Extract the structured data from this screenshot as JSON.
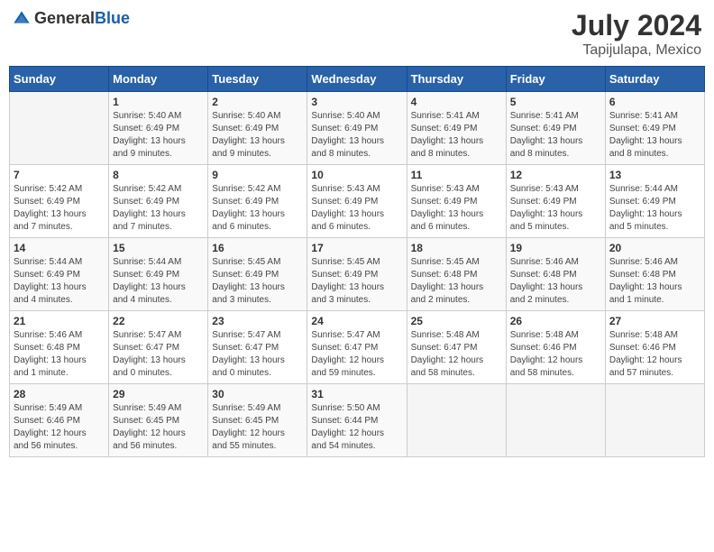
{
  "header": {
    "logo_general": "General",
    "logo_blue": "Blue",
    "month": "July 2024",
    "location": "Tapijulapa, Mexico"
  },
  "weekdays": [
    "Sunday",
    "Monday",
    "Tuesday",
    "Wednesday",
    "Thursday",
    "Friday",
    "Saturday"
  ],
  "weeks": [
    [
      {
        "day": "",
        "detail": ""
      },
      {
        "day": "1",
        "detail": "Sunrise: 5:40 AM\nSunset: 6:49 PM\nDaylight: 13 hours\nand 9 minutes."
      },
      {
        "day": "2",
        "detail": "Sunrise: 5:40 AM\nSunset: 6:49 PM\nDaylight: 13 hours\nand 9 minutes."
      },
      {
        "day": "3",
        "detail": "Sunrise: 5:40 AM\nSunset: 6:49 PM\nDaylight: 13 hours\nand 8 minutes."
      },
      {
        "day": "4",
        "detail": "Sunrise: 5:41 AM\nSunset: 6:49 PM\nDaylight: 13 hours\nand 8 minutes."
      },
      {
        "day": "5",
        "detail": "Sunrise: 5:41 AM\nSunset: 6:49 PM\nDaylight: 13 hours\nand 8 minutes."
      },
      {
        "day": "6",
        "detail": "Sunrise: 5:41 AM\nSunset: 6:49 PM\nDaylight: 13 hours\nand 8 minutes."
      }
    ],
    [
      {
        "day": "7",
        "detail": "Sunrise: 5:42 AM\nSunset: 6:49 PM\nDaylight: 13 hours\nand 7 minutes."
      },
      {
        "day": "8",
        "detail": "Sunrise: 5:42 AM\nSunset: 6:49 PM\nDaylight: 13 hours\nand 7 minutes."
      },
      {
        "day": "9",
        "detail": "Sunrise: 5:42 AM\nSunset: 6:49 PM\nDaylight: 13 hours\nand 6 minutes."
      },
      {
        "day": "10",
        "detail": "Sunrise: 5:43 AM\nSunset: 6:49 PM\nDaylight: 13 hours\nand 6 minutes."
      },
      {
        "day": "11",
        "detail": "Sunrise: 5:43 AM\nSunset: 6:49 PM\nDaylight: 13 hours\nand 6 minutes."
      },
      {
        "day": "12",
        "detail": "Sunrise: 5:43 AM\nSunset: 6:49 PM\nDaylight: 13 hours\nand 5 minutes."
      },
      {
        "day": "13",
        "detail": "Sunrise: 5:44 AM\nSunset: 6:49 PM\nDaylight: 13 hours\nand 5 minutes."
      }
    ],
    [
      {
        "day": "14",
        "detail": "Sunrise: 5:44 AM\nSunset: 6:49 PM\nDaylight: 13 hours\nand 4 minutes."
      },
      {
        "day": "15",
        "detail": "Sunrise: 5:44 AM\nSunset: 6:49 PM\nDaylight: 13 hours\nand 4 minutes."
      },
      {
        "day": "16",
        "detail": "Sunrise: 5:45 AM\nSunset: 6:49 PM\nDaylight: 13 hours\nand 3 minutes."
      },
      {
        "day": "17",
        "detail": "Sunrise: 5:45 AM\nSunset: 6:49 PM\nDaylight: 13 hours\nand 3 minutes."
      },
      {
        "day": "18",
        "detail": "Sunrise: 5:45 AM\nSunset: 6:48 PM\nDaylight: 13 hours\nand 2 minutes."
      },
      {
        "day": "19",
        "detail": "Sunrise: 5:46 AM\nSunset: 6:48 PM\nDaylight: 13 hours\nand 2 minutes."
      },
      {
        "day": "20",
        "detail": "Sunrise: 5:46 AM\nSunset: 6:48 PM\nDaylight: 13 hours\nand 1 minute."
      }
    ],
    [
      {
        "day": "21",
        "detail": "Sunrise: 5:46 AM\nSunset: 6:48 PM\nDaylight: 13 hours\nand 1 minute."
      },
      {
        "day": "22",
        "detail": "Sunrise: 5:47 AM\nSunset: 6:47 PM\nDaylight: 13 hours\nand 0 minutes."
      },
      {
        "day": "23",
        "detail": "Sunrise: 5:47 AM\nSunset: 6:47 PM\nDaylight: 13 hours\nand 0 minutes."
      },
      {
        "day": "24",
        "detail": "Sunrise: 5:47 AM\nSunset: 6:47 PM\nDaylight: 12 hours\nand 59 minutes."
      },
      {
        "day": "25",
        "detail": "Sunrise: 5:48 AM\nSunset: 6:47 PM\nDaylight: 12 hours\nand 58 minutes."
      },
      {
        "day": "26",
        "detail": "Sunrise: 5:48 AM\nSunset: 6:46 PM\nDaylight: 12 hours\nand 58 minutes."
      },
      {
        "day": "27",
        "detail": "Sunrise: 5:48 AM\nSunset: 6:46 PM\nDaylight: 12 hours\nand 57 minutes."
      }
    ],
    [
      {
        "day": "28",
        "detail": "Sunrise: 5:49 AM\nSunset: 6:46 PM\nDaylight: 12 hours\nand 56 minutes."
      },
      {
        "day": "29",
        "detail": "Sunrise: 5:49 AM\nSunset: 6:45 PM\nDaylight: 12 hours\nand 56 minutes."
      },
      {
        "day": "30",
        "detail": "Sunrise: 5:49 AM\nSunset: 6:45 PM\nDaylight: 12 hours\nand 55 minutes."
      },
      {
        "day": "31",
        "detail": "Sunrise: 5:50 AM\nSunset: 6:44 PM\nDaylight: 12 hours\nand 54 minutes."
      },
      {
        "day": "",
        "detail": ""
      },
      {
        "day": "",
        "detail": ""
      },
      {
        "day": "",
        "detail": ""
      }
    ]
  ]
}
